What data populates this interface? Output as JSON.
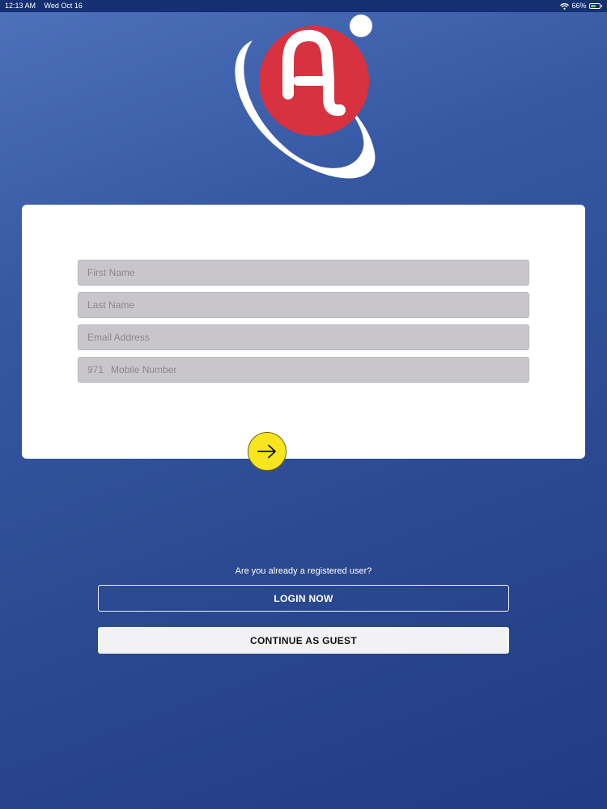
{
  "status_bar": {
    "time": "12:13 AM",
    "date": "Wed Oct 16",
    "battery_percent": "66%",
    "battery_level": 0.66,
    "icons": [
      "wifi-icon",
      "battery-icon"
    ]
  },
  "logo": {
    "icon": "app-logo",
    "letter": "A",
    "colors": {
      "circle": "#d8313f",
      "orbit": "#ffffff",
      "dot": "#ffffff"
    }
  },
  "form": {
    "first_name_placeholder": "First Name",
    "last_name_placeholder": "Last Name",
    "email_placeholder": "Email Address",
    "country_code": "971",
    "mobile_placeholder": "Mobile Number",
    "next_button_icon": "arrow-right-icon"
  },
  "auth": {
    "registered_question": "Are you already a registered user?",
    "login_label": "LOGIN NOW",
    "guest_label": "CONTINUE AS GUEST"
  },
  "colors": {
    "background_top": "#4e71bc",
    "background_bottom": "#213c82",
    "status_bar": "#142f72",
    "field_bg": "#c8c6ca",
    "accent_yellow": "#f8e51e"
  }
}
